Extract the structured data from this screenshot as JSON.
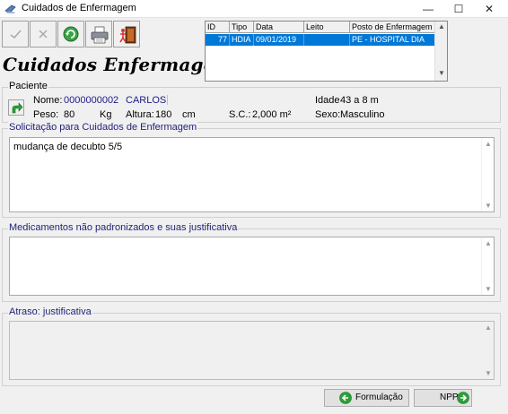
{
  "window": {
    "title": "Cuidados de Enfermagem",
    "minimize": "—",
    "maximize": "☐",
    "close": "✕"
  },
  "toolbar": {
    "buttons": [
      "confirm",
      "cancel",
      "refresh",
      "print",
      "exit"
    ]
  },
  "heading": "Cuidados Enfermagem",
  "grid": {
    "columns": [
      "ID",
      "Tipo",
      "Data",
      "Leito",
      "Posto de Enfermagem"
    ],
    "rows": [
      {
        "id": "77",
        "tipo": "HDIA",
        "data": "09/01/2019",
        "leito": "",
        "posto": "PE - HOSPITAL DIA"
      }
    ]
  },
  "paciente": {
    "legend": "Paciente",
    "nome_label": "Nome:",
    "nome_id": "0000000002",
    "nome": "CARLOS",
    "idade_label": "Idade",
    "idade_value": "43 a 8 m",
    "peso_label": "Peso:",
    "peso_value": "80",
    "peso_unit": "Kg",
    "altura_label": "Altura:",
    "altura_value": "180",
    "altura_unit": "cm",
    "sc_label": "S.C.:",
    "sc_value": "2,000 m²",
    "sexo_label": "Sexo:",
    "sexo_value": "Masculino"
  },
  "solicitacao": {
    "legend": "Solicitação para Cuidados de Enfermagem",
    "text": "mudança de decubto 5/5"
  },
  "medicamentos": {
    "legend": "Medicamentos não padronizados e suas justificativa",
    "text": ""
  },
  "atraso": {
    "legend": "Atraso: justificativa",
    "text": ""
  },
  "buttons": {
    "formulacao": "Formulação",
    "npp": "NPP"
  },
  "colors": {
    "selection": "#0078d7",
    "legend_text": "#1f1f7a",
    "patient_data": "#1a1a8a",
    "green_icon": "#2e9e3a"
  }
}
